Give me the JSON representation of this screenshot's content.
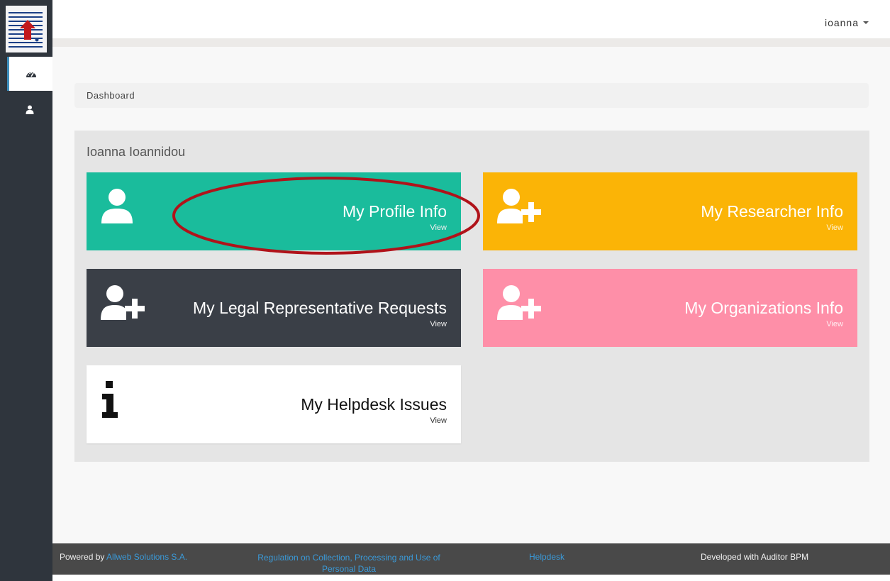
{
  "topbar": {
    "user_label": "ioanna"
  },
  "breadcrumb": {
    "label": "Dashboard"
  },
  "panel": {
    "title": "Ioanna Ioannidou"
  },
  "tiles": [
    {
      "title": "My Profile Info",
      "view": "View",
      "icon": "user-icon",
      "color": "#1abc9c"
    },
    {
      "title": "My Researcher Info",
      "view": "View",
      "icon": "user-plus-icon",
      "color": "#fbb406"
    },
    {
      "title": "My Legal Representative Requests",
      "view": "View",
      "icon": "user-plus-icon",
      "color": "#3a3f47"
    },
    {
      "title": "My Organizations Info",
      "view": "View",
      "icon": "user-plus-icon",
      "color": "#fe8fa8"
    },
    {
      "title": "My Helpdesk Issues",
      "view": "View",
      "icon": "info-icon",
      "color": "#ffffff"
    }
  ],
  "sidebar": {
    "items": [
      {
        "icon": "dashboard-icon",
        "active": true
      },
      {
        "icon": "user-icon",
        "active": false
      }
    ]
  },
  "footer": {
    "powered_prefix": "Powered by ",
    "powered_link": "Allweb Solutions S.A.",
    "regulation_link": "Regulation on Collection, Processing and Use of Personal Data",
    "helpdesk_link": "Helpdesk",
    "developed": "Developed with Auditor BPM"
  },
  "colors": {
    "sidebar": "#2f353d",
    "footer": "#494949",
    "link": "#3a9ad9",
    "annotation": "#b0131a"
  }
}
